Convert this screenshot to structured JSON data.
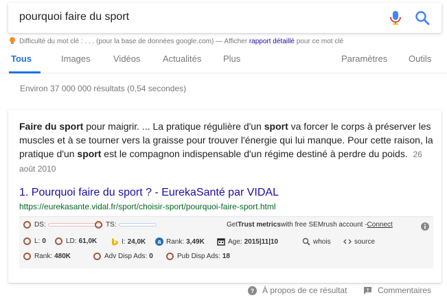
{
  "search": {
    "query": "pourquoi faire du sport"
  },
  "keyword": {
    "prefix": "Difficulté du mot clé : ",
    "dots": ". . .",
    "middle": " (pour la base de données google.com) — Afficher ",
    "link": "rapport détaillé",
    "suffix": " pour ce mot clé"
  },
  "tabs": [
    {
      "label": "Tous"
    },
    {
      "label": "Images"
    },
    {
      "label": "Vidéos"
    },
    {
      "label": "Actualités"
    },
    {
      "label": "Plus"
    },
    {
      "label": "Paramètres"
    },
    {
      "label": "Outils"
    }
  ],
  "stats": "Environ 37 000 000 résultats (0,54 secondes)",
  "snippet": {
    "b1": "Faire du sport",
    "t1": " pour maigrir. ... La pratique régulière d'un ",
    "b2": "sport",
    "t2": " va forcer le corps à préserver les muscles et à se tourner vers la graisse pour trouver l'énergie qui lui manque. Pour cette raison, la pratique d'un ",
    "b3": "sport",
    "t3": " est le compagnon indispensable d'un régime destiné à perdre du poids.",
    "date": "26 août 2010"
  },
  "result": {
    "title": "1. Pourquoi faire du sport ? - EurekaSanté par VIDAL",
    "url": "https://eurekasante.vidal.fr/sport/choisir-sport/pourquoi-faire-sport.html"
  },
  "semrush": {
    "ds": "DS:",
    "ts": "TS:",
    "get": "Get ",
    "trust": "Trust metrics",
    "with": " with free SEMrush account - ",
    "connect": "Connect",
    "l_label": "L:",
    "l_val": "0",
    "ld_label": "LD:",
    "ld_val": "61,0K",
    "i_label": "I:",
    "i_val": "24,0K",
    "rank_label": "Rank:",
    "rank_val": "3,49K",
    "age_label": "Age:",
    "age_val": "2015|11|10",
    "whois": "whois",
    "source": "source",
    "rank2_label": "Rank:",
    "rank2_val": "480K",
    "adv_label": "Adv Disp Ads:",
    "adv_val": "0",
    "pub_label": "Pub Disp Ads:",
    "pub_val": "18"
  },
  "footer": {
    "about": "À propos de ce résultat",
    "comments": "Commentaires"
  },
  "colors": {
    "accent": "#1a73e8",
    "link": "#1a0dab",
    "url": "#006621",
    "ring": "#a35a40"
  }
}
